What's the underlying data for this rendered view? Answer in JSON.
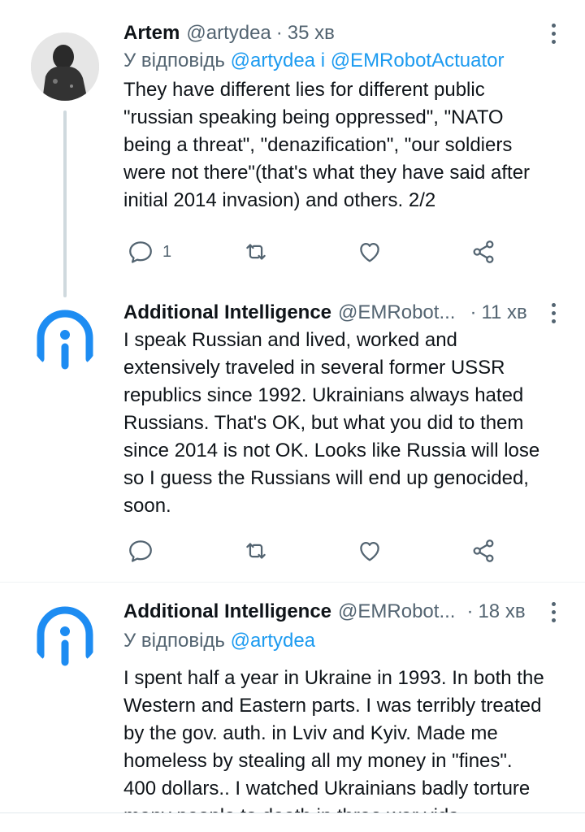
{
  "tweets": [
    {
      "name": "Artem",
      "handle": "@artydea",
      "time": "35 хв",
      "reply_prefix": "У відповідь",
      "reply_handles": "@artydea і @EMRobotActuator",
      "text": "They have different lies for different public\n\"russian speaking being oppressed\", \"NATO\nbeing a threat\", \"denazification\", \"our soldiers\nwere not there\"(that's what they have said after\ninitial 2014 invasion) and others. 2/2",
      "reply_count": "1",
      "avatar_icon": "person-photo-avatar"
    },
    {
      "name": "Additional Intelligence",
      "handle": "@EMRobot...",
      "time": "11 хв",
      "text": "I speak Russian and lived, worked and\nextensively traveled in several former USSR\nrepublics since 1992. Ukrainians always hated\nRussians. That's OK, but what you did to them\nsince 2014 is not OK. Looks like Russia will lose\nso I guess the Russians will end up genocided,\nsoon.",
      "avatar_icon": "ai-logo-avatar"
    },
    {
      "name": "Additional Intelligence",
      "handle": "@EMRobot...",
      "time": "18 хв",
      "reply_prefix": "У відповідь",
      "reply_handles": "@artydea",
      "text": "I spent half a year in Ukraine in 1993. In both the\nWestern and Eastern parts. I was terribly treated\nby the gov. auth. in Lviv and Kyiv. Made me\nhomeless by stealing all my money in \"fines\".\n400 dollars.. I watched Ukrainians badly torture\nmany people to death in three war vids",
      "avatar_icon": "ai-logo-avatar"
    }
  ],
  "separator": "·",
  "icons": [
    "reply-icon",
    "retweet-icon",
    "like-icon",
    "share-icon",
    "more-icon"
  ],
  "colors": {
    "accent": "#1d9bf0",
    "muted": "#536471",
    "text": "#0f1419",
    "logo": "#1d8cf2"
  }
}
